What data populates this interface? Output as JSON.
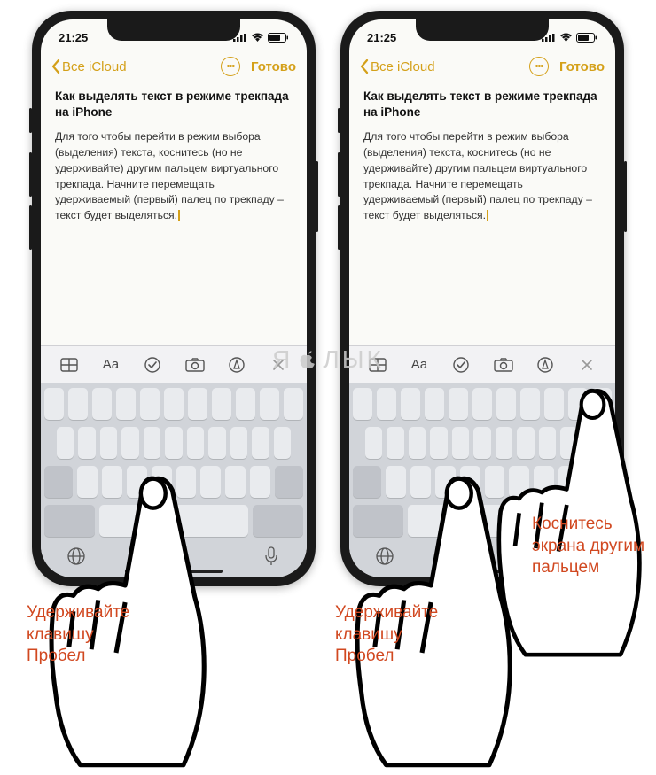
{
  "status": {
    "time": "21:25"
  },
  "nav": {
    "back_label": "Все iCloud",
    "done_label": "Готово"
  },
  "note": {
    "title": "Как выделять текст в режиме трекпада на iPhone",
    "body": "Для того чтобы перейти в режим выбора (выделения) текста, коснитесь (но не удерживайте) другим пальцем виртуального трекпада. Начните перемещать удерживаемый (первый) палец по трекпаду – текст будет выделяться."
  },
  "toolbar": {
    "text_style_label": "Aa"
  },
  "captions": {
    "hold_space": "Удерживайте\nклавишу\nПробел",
    "tap_second": "Коснитесь\nэкрана другим\nпальцем"
  },
  "watermark": {
    "prefix": "Я",
    "suffix": "ЛЫК"
  }
}
